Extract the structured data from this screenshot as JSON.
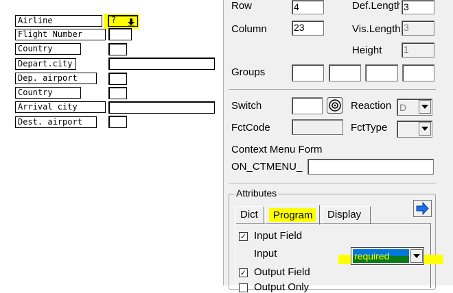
{
  "screen": {
    "rows": [
      {
        "label": "Airline",
        "field_value": "?"
      },
      {
        "label": "Flight Number",
        "field_value": ""
      },
      {
        "label": "Country",
        "field_value": ""
      },
      {
        "label": "Depart.city",
        "field_value": ""
      },
      {
        "label": "Dep. airport",
        "field_value": ""
      },
      {
        "label": "Country",
        "field_value": ""
      },
      {
        "label": "Arrival city",
        "field_value": ""
      },
      {
        "label": "Dest. airport",
        "field_value": ""
      }
    ],
    "highlight_color": "#ffff00"
  },
  "panel": {
    "row_label": "Row",
    "row_value": "4",
    "column_label": "Column",
    "column_value": "23",
    "def_length_label": "Def.Length",
    "def_length_value": "3",
    "vis_length_label": "Vis.Length",
    "vis_length_value": "3",
    "height_label": "Height",
    "height_value": "1",
    "groups_label": "Groups",
    "switch_label": "Switch",
    "reaction_label": "Reaction",
    "reaction_value": "D",
    "fctcode_label": "FctCode",
    "fcttype_label": "FctType",
    "context_menu_label": "Context Menu Form",
    "ctmenu_label": "ON_CTMENU_",
    "attributes_label": "Attributes",
    "tabs": [
      "Dict",
      "Program",
      "Display"
    ],
    "active_tab": "Program",
    "input_field_label": "Input Field",
    "input_field_checked": true,
    "input_label": "Input",
    "input_value": "required",
    "output_field_label": "Output Field",
    "output_field_checked": true,
    "output_only_label": "Output Only",
    "select_color": "#0078d7",
    "select_text_color": "#ffff00"
  }
}
